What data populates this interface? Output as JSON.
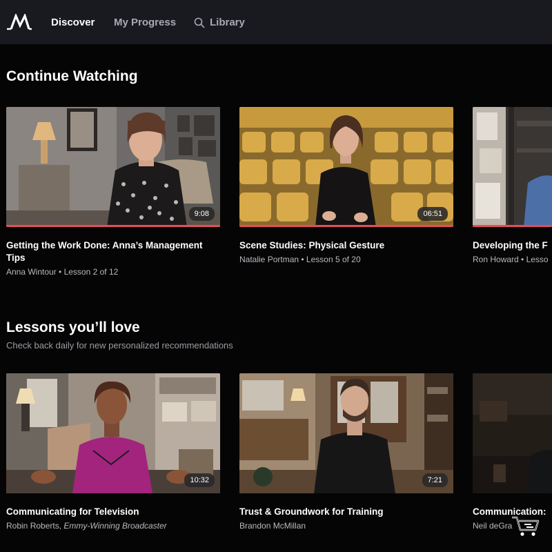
{
  "nav": {
    "items": [
      {
        "label": "Discover",
        "active": true
      },
      {
        "label": "My Progress",
        "active": false
      },
      {
        "label": "Library",
        "active": false,
        "icon": "search-icon"
      }
    ],
    "logo_icon": "masterclass-logo-icon"
  },
  "continue_watching": {
    "title": "Continue Watching",
    "cards": [
      {
        "title": "Getting the Work Done: Anna’s Management Tips",
        "instructor": "Anna Wintour",
        "lesson": "Lesson 2 of 12",
        "duration": "9:08",
        "progress": 1.0
      },
      {
        "title": "Scene Studies: Physical Gesture",
        "instructor": "Natalie Portman",
        "lesson": "Lesson 5 of 20",
        "duration": "06:51",
        "progress": 1.0
      },
      {
        "title": "Developing the F",
        "instructor": "Ron Howard",
        "lesson": "Lesso",
        "progress": 1.0
      }
    ]
  },
  "lessons": {
    "title": "Lessons you’ll love",
    "subtitle": "Check back daily for new personalized recommendations",
    "cards": [
      {
        "title": "Communicating for Television",
        "instructor": "Robin Roberts",
        "tagline": "Emmy-Winning Broadcaster",
        "duration": "10:32"
      },
      {
        "title": "Trust & Groundwork for Training",
        "instructor": "Brandon McMillan",
        "duration": "7:21"
      },
      {
        "title": "Communication:",
        "instructor": "Neil deGra"
      }
    ]
  },
  "colors": {
    "accent": "#e64d5a",
    "nav_bg": "#181a1f",
    "page_bg": "#050505"
  },
  "cart_icon": "shopping-cart-icon"
}
